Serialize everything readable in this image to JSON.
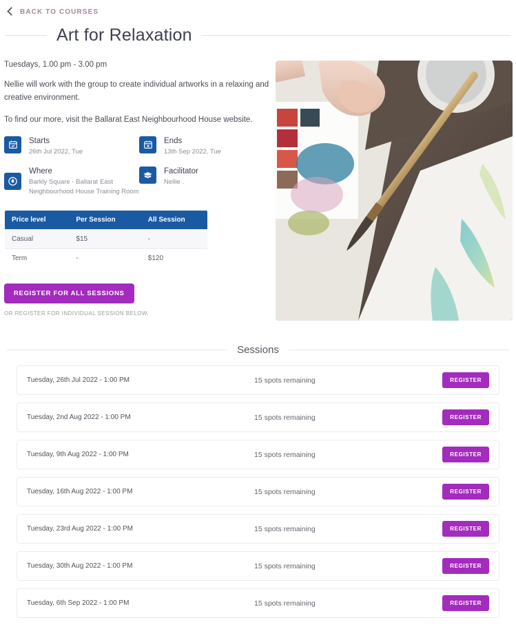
{
  "back_link": {
    "label": "BACK TO COURSES",
    "icon": "chevron-left-icon"
  },
  "header": {
    "title": "Art for Relaxation"
  },
  "overview": {
    "schedule": "Tuesdays, 1.00 pm - 3.00 pm",
    "paragraph_1": "Nellie will work with the group to create individual artworks in a relaxing and creative environment.",
    "paragraph_2": "To find our more, visit the Ballarat East Neighbourhood House website."
  },
  "info": [
    {
      "icon": "calendar-check-icon",
      "label": "Starts",
      "value": "26th Jul 2022, Tue"
    },
    {
      "icon": "calendar-x-icon",
      "label": "Ends",
      "value": "13th Sep 2022, Tue"
    },
    {
      "icon": "location-pin-icon",
      "label": "Where",
      "value": "Barkly Square - Ballarat East Neighbourhood House Training Room"
    },
    {
      "icon": "graduation-cap-icon",
      "label": "Facilitator",
      "value": "Nellie ."
    }
  ],
  "price_table": {
    "columns": [
      "Price level",
      "Per Session",
      "All Session"
    ],
    "rows": [
      [
        "Casual",
        "$15",
        "-"
      ],
      [
        "Term",
        "-",
        "$120"
      ]
    ]
  },
  "cta": {
    "register_all_label": "REGISTER FOR ALL SESSIONS",
    "note": "OR REGISTER FOR INDIVIDUAL SESSION BELOW."
  },
  "hero": {
    "alt": "hand painting watercolour artwork with brush on paper"
  },
  "sessions": {
    "heading": "Sessions",
    "register_label": "REGISTER",
    "items": [
      {
        "date": "Tuesday, 26th Jul 2022 - 1:00 PM",
        "spots": "15 spots remaining"
      },
      {
        "date": "Tuesday, 2nd Aug 2022 - 1:00 PM",
        "spots": "15 spots remaining"
      },
      {
        "date": "Tuesday, 9th Aug 2022 - 1:00 PM",
        "spots": "15 spots remaining"
      },
      {
        "date": "Tuesday, 16th Aug 2022 - 1:00 PM",
        "spots": "15 spots remaining"
      },
      {
        "date": "Tuesday, 23rd Aug 2022 - 1:00 PM",
        "spots": "15 spots remaining"
      },
      {
        "date": "Tuesday, 30th Aug 2022 - 1:00 PM",
        "spots": "15 spots remaining"
      },
      {
        "date": "Tuesday, 6th Sep 2022 - 1:00 PM",
        "spots": "15 spots remaining"
      }
    ]
  },
  "colors": {
    "accent_purple": "#a32bbd",
    "accent_blue": "#1a5aa3",
    "back_link": "#a9859c",
    "text": "#3f4150"
  }
}
